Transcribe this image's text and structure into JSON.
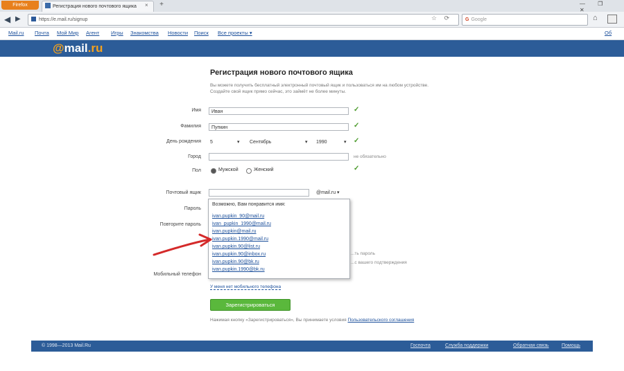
{
  "browser": {
    "menu_button": "Firefox",
    "tab_title": "Регистрация нового почтового ящика",
    "tab_close": "×",
    "new_tab": "+",
    "window_buttons": "— ❐ ✕",
    "url": "https://e.mail.ru/signup",
    "search_engine": "G",
    "search_placeholder": "Google"
  },
  "portal_nav": {
    "items": [
      "Mail.ru",
      "Почта",
      "Мой Мир",
      "Агент",
      "Игры",
      "Знакомства",
      "Новости",
      "Поиск",
      "Все проекты ▾"
    ],
    "right": "Об"
  },
  "logo": {
    "at": "@",
    "name": "mail",
    "domain": ".ru"
  },
  "form": {
    "title": "Регистрация нового почтового ящика",
    "description": "Вы можете получить бесплатный электронный почтовый ящик и пользоваться им на любом устройстве. Создайте свой ящик прямо сейчас, это займёт не более минуты.",
    "first_name": {
      "label": "Имя",
      "value": "Иван"
    },
    "last_name": {
      "label": "Фамилия",
      "value": "Пупкин"
    },
    "birthday": {
      "label": "День рождения",
      "day": "5",
      "month": "Сентябрь",
      "year": "1990"
    },
    "city": {
      "label": "Город",
      "hint": "не обязательно"
    },
    "gender": {
      "label": "Пол",
      "male": "Мужской",
      "female": "Женский"
    },
    "email": {
      "label": "Почтовый ящик",
      "domain": "@mail.ru ▾"
    },
    "password": {
      "label": "Пароль"
    },
    "password_repeat": {
      "label": "Повторите пароль"
    },
    "phone": {
      "label": "Мобильный телефон"
    },
    "password_side_note_1": "...ть пароль",
    "password_side_note_2": "...с вашего подтверждения",
    "no_phone_link": "У меня нет мобильного телефона",
    "register_button": "Зарегистрироваться",
    "terms_text": "Нажимая кнопку «Зарегистрироваться», Вы принимаете условия",
    "terms_link": "Пользовательского соглашения"
  },
  "dropdown": {
    "header": "Возможно, Вам понравится имя:",
    "items": [
      "ivan.pupkin_90@mail.ru",
      "ivan_pupkin_1990@mail.ru",
      "ivan.pupkin@mail.ru",
      "ivan.pupkin.1990@mail.ru",
      "ivan.pupkin.90@list.ru",
      "ivan.pupkin.90@inbox.ru",
      "ivan.pupkin.90@bk.ru",
      "ivan.pupkin.1990@bk.ru"
    ]
  },
  "footer": {
    "copyright": "© 1998—2013 Mail.Ru",
    "links": [
      "Госпочта",
      "Служба поддержки",
      "Обратная связь",
      "Помощь"
    ]
  },
  "colors": {
    "header": "#2c5c98",
    "logo_accent": "#f7a21c",
    "button": "#5ab83c",
    "check": "#4a9a2a",
    "arrow": "#d42a2a"
  }
}
